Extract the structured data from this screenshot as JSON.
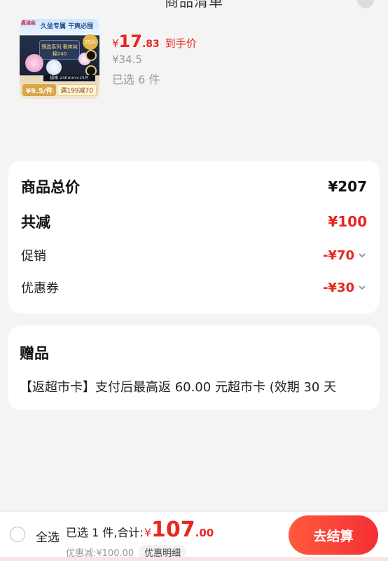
{
  "header": {
    "title": "商品清单"
  },
  "product": {
    "thumb": {
      "head_text": "久坐专属 干爽必囤",
      "logo_text": "高洁丝",
      "badge_text": "25片",
      "center_text": "臻选系列 奢爽纯棉240",
      "strip_text": "规格 240mm×25片",
      "price_text": "¥9.5/件",
      "promo_text": "满199减70"
    },
    "currency": "¥",
    "price_int": "17",
    "price_dec": ".83",
    "price_tag": "到手价",
    "orig_price": "¥34.5",
    "selected_count": "已选 6 件"
  },
  "summary": {
    "total_label": "商品总价",
    "total_value": "¥207",
    "reduce_label": "共减",
    "reduce_value": "¥100",
    "promo_label": "促销",
    "promo_value": "-¥70",
    "coupon_label": "优惠券",
    "coupon_value": "-¥30"
  },
  "gift": {
    "title": "赠品",
    "text": "【返超市卡】支付后最高返 60.00 元超市卡 (效期 30 天"
  },
  "bottom_bar": {
    "select_all": "全选",
    "total_prefix": "已选 1 件,合计:",
    "total_currency": "¥",
    "total_int": "107",
    "total_dec": ".00",
    "discount_text": "优惠减:¥100.00",
    "detail_link": "优惠明细",
    "checkout_label": "去结算"
  },
  "colors": {
    "accent_red": "#e8271f",
    "checkout_gradient_start": "#ff5a3c",
    "checkout_gradient_end": "#f52f35",
    "background": "#f4f4f4"
  },
  "icons": {
    "chevron": "chevron-down-icon",
    "radio": "radio-unchecked-icon",
    "close": "close-icon"
  }
}
